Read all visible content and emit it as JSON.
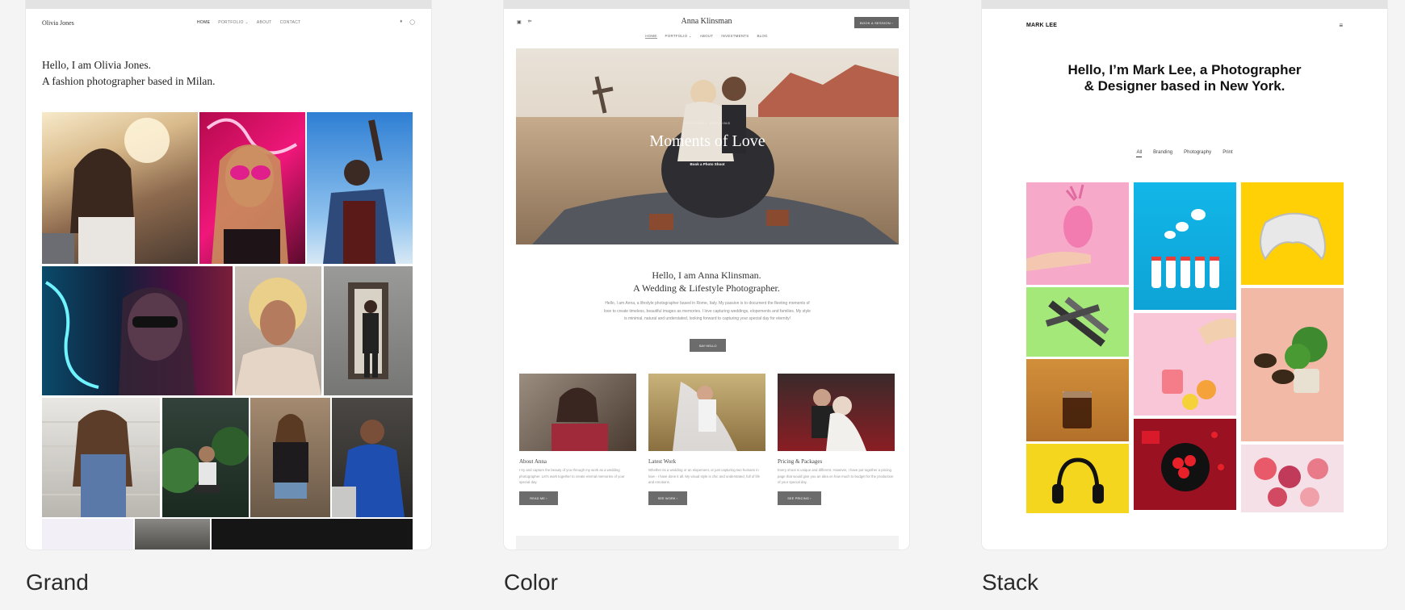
{
  "templates": [
    {
      "label": "Grand",
      "site_name": "Olivia Jones",
      "nav": [
        "HOME",
        "PORTFOLIO ⌄",
        "ABOUT",
        "CONTACT"
      ],
      "intro_line1": "Hello, I am Olivia Jones.",
      "intro_line2": "A fashion photographer based in Milan."
    },
    {
      "label": "Color",
      "site_name": "Anna Klinsman",
      "book_button": "BOOK A SESSION  ›",
      "nav": [
        "HOME",
        "PORTFOLIO ⌄",
        "ABOUT",
        "INVESTMENTS",
        "BLOG"
      ],
      "hero_kicker": "PERSONAL WEDDING",
      "hero_title": "Moments of Love",
      "hero_sub": "Book a Photo Shoot",
      "intro_line1": "Hello, I am Anna Klinsman.",
      "intro_line2": "A Wedding & Lifestyle Photographer.",
      "intro_body": "Hello, I am Anna, a lifestyle photographer based in Rome, Italy. My passion is to document the fleeting moments of love to create timeless, beautiful images as memories. I love capturing weddings, elopements and families. My style is minimal, natural and understated, looking forward to capturing your special day for eternity!",
      "say_hello": "SAY HELLO",
      "columns": [
        {
          "title": "About Anna",
          "text": "I try and capture the beauty of you through my work as a wedding photographer. Let's work together to create eternal memories of your special day.",
          "button": "READ ME  ›"
        },
        {
          "title": "Latest Work",
          "text": "Whether its a wedding or an elopement, or just capturing two humans in love - I have done it all. My visual style is chic and understated, full of life and emotions.",
          "button": "SEE WORK  ›"
        },
        {
          "title": "Pricing & Packages",
          "text": "Every shoot is unique and different. However, I have put together a pricing page that would give you an idea on how much to budget for the production of your special day.",
          "button": "SEE PRICING  ›"
        }
      ]
    },
    {
      "label": "Stack",
      "site_name": "MARK LEE",
      "headline": "Hello, I’m Mark Lee, a Photographer & Designer based in New York.",
      "tabs": [
        "All",
        "Branding",
        "Photography",
        "Print"
      ]
    }
  ],
  "icons": {
    "grand_social": [
      "twitter-icon",
      "instagram-icon"
    ],
    "color_social": [
      "instagram-icon",
      "share-icon"
    ],
    "stack_menu": "hamburger-menu-icon"
  },
  "colors": {
    "page_background": "#f4f4f4",
    "card_background": "#ffffff",
    "button_gray": "#6c6c6c"
  }
}
